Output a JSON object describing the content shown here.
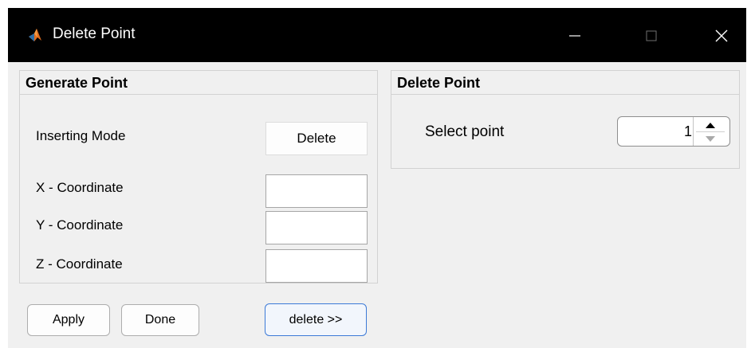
{
  "window": {
    "title": "Delete Point",
    "icon": "matlab-icon",
    "controls": [
      "minimize-icon",
      "maximize-icon",
      "close-icon"
    ]
  },
  "generate_panel": {
    "title": "Generate Point",
    "inserting_mode_label": "Inserting Mode",
    "inserting_mode_button": "Delete",
    "x_label": "X - Coordinate",
    "y_label": "Y - Coordinate",
    "z_label": "Z - Coordinate",
    "x_value": "",
    "y_value": "",
    "z_value": ""
  },
  "delete_panel": {
    "title": "Delete Point",
    "select_label": "Select point",
    "select_value": "1"
  },
  "buttons": {
    "apply": "Apply",
    "done": "Done",
    "toggle": "delete >>"
  },
  "colors": {
    "titlebar": "#000000",
    "background": "#f0f0f0",
    "focus_border": "#3c7ad7"
  }
}
